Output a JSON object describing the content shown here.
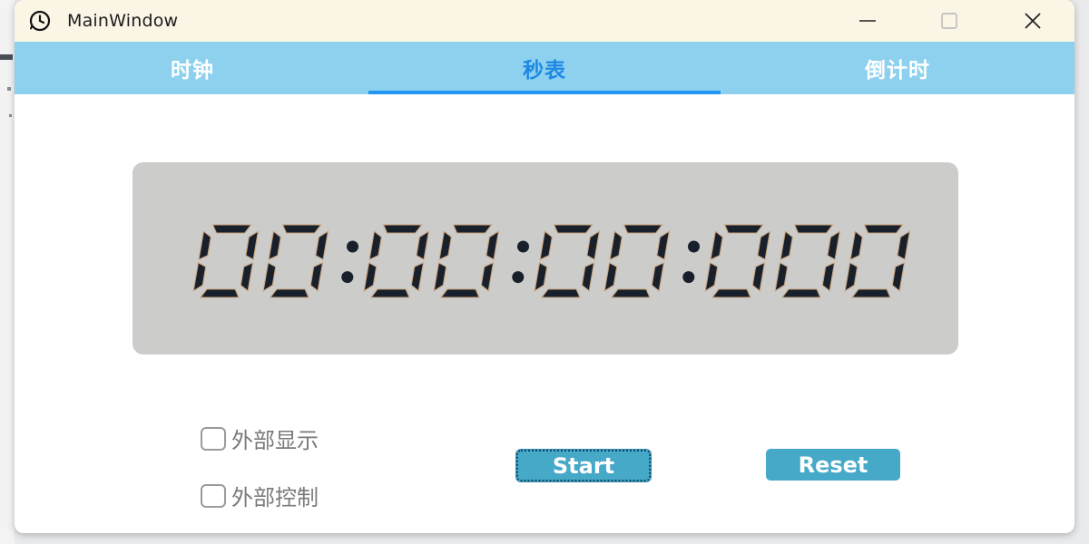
{
  "window": {
    "title": "MainWindow",
    "icon": "clock-icon",
    "controls": [
      "minimize-icon",
      "maximize-icon",
      "close-icon"
    ]
  },
  "tabs": [
    {
      "label": "时钟"
    },
    {
      "label": "秒表"
    },
    {
      "label": "倒计时"
    }
  ],
  "active_tab": "秒表",
  "display": {
    "time": "00:00:00:000"
  },
  "options": {
    "external_display": {
      "label": "外部显示",
      "checked": false
    },
    "external_control": {
      "label": "外部控制",
      "checked": false
    }
  },
  "buttons": {
    "start": "Start",
    "reset": "Reset"
  },
  "colors": {
    "titlebar": "#fbf5e6",
    "tabbar": "#8dd1ee",
    "active_tab": "#1e88e5",
    "lcd_background": "#cccccb",
    "digit": "#17202b",
    "digit_edge": "#c9a27a",
    "button": "#47a9c8"
  }
}
